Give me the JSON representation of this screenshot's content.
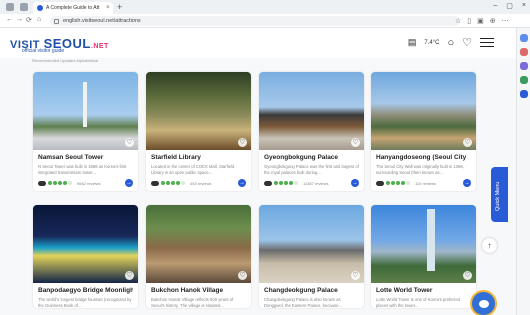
{
  "browser": {
    "tab_title": "A Complete Guide to Att",
    "tab_close": "×",
    "new_tab": "+",
    "url": "english.visitseoul.net/attractions",
    "nav": {
      "back": "←",
      "forward": "→",
      "refresh": "⟳",
      "home": "⌂"
    },
    "window": {
      "minimize": "–",
      "maximize": "▢",
      "close": "×"
    }
  },
  "site": {
    "logo_visit": "VISIT",
    "logo_seoul": "SEOUL",
    "logo_net": ".NET",
    "logo_sub": "official visitor guide",
    "weather": "7.4°C",
    "filter_text": "Recommended    Updated    Alphabetical"
  },
  "cards": [
    {
      "title": "Namsan Seoul Tower",
      "desc": "N Seoul Tower was built in 1969 as Korea's first integrated transmission tower...",
      "reviews": "9662 reviews",
      "rating": 4,
      "image": "tower"
    },
    {
      "title": "Starfield Library",
      "desc": "Located in the center of COEX Mall, Starfield Library is an open public space...",
      "reviews": "453 reviews",
      "rating": 4,
      "image": "library"
    },
    {
      "title": "Gyeongbokgung Palace",
      "desc": "Gyeongbokgung Palace was the first and largest of the royal palaces built during...",
      "reviews": "11387 reviews",
      "rating": 4,
      "image": "palace"
    },
    {
      "title": "Hanyangdoseong (Seoul City",
      "desc": "The Seoul City Wall was originally built in 1396, surrounding Seoul (then known as...",
      "reviews": "110 reviews",
      "rating": 4,
      "image": "wall"
    },
    {
      "title": "Banpodaegyo Bridge Moonligh",
      "desc": "The world's longest bridge fountain (recognized by the Guinness Book of...",
      "reviews": "",
      "rating": 0,
      "image": "bridge"
    },
    {
      "title": "Bukchon Hanok Village",
      "desc": "Bukchon Hanok Village reflects 600 years of Seoul's history. The village is situated...",
      "reviews": "",
      "rating": 0,
      "image": "hanok"
    },
    {
      "title": "Changdeokgung Palace",
      "desc": "Changdeokgung Palace is also known as Donggwol, the Eastern Palace, because...",
      "reviews": "",
      "rating": 0,
      "image": "palace2"
    },
    {
      "title": "Lotte World Tower",
      "desc": "Lotte World Tower is one of Korea's preferred places with the tower...",
      "reviews": "",
      "rating": 0,
      "image": "lotte"
    }
  ],
  "quick_menu": "Quick Menu",
  "to_top": "↑",
  "colors": {
    "brand": "#1e4fa8",
    "accent": "#2a5bd7",
    "rating": "#4caf50"
  }
}
